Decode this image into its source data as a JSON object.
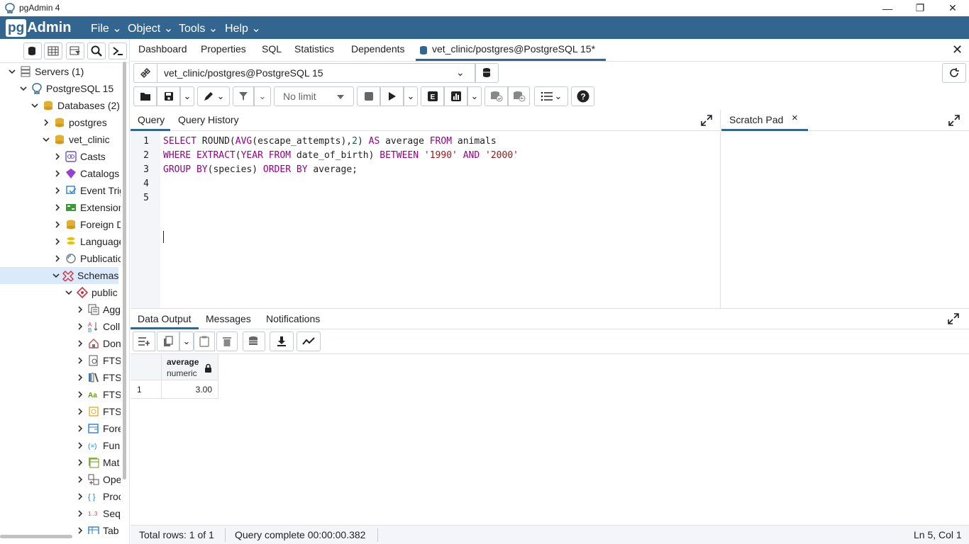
{
  "window": {
    "title": "pgAdmin 4"
  },
  "menubar": {
    "logo_pg": "pg",
    "logo_admin": "Admin",
    "items": [
      "File",
      "Object",
      "Tools",
      "Help"
    ]
  },
  "sidebar": {
    "tree": [
      {
        "label": "Servers (1)"
      },
      {
        "label": "PostgreSQL 15"
      },
      {
        "label": "Databases (2)"
      },
      {
        "label": "postgres"
      },
      {
        "label": "vet_clinic"
      },
      {
        "label": "Casts"
      },
      {
        "label": "Catalogs"
      },
      {
        "label": "Event Trig"
      },
      {
        "label": "Extension"
      },
      {
        "label": "Foreign D"
      },
      {
        "label": "Language"
      },
      {
        "label": "Publicatio"
      },
      {
        "label": "Schemas"
      },
      {
        "label": "public"
      },
      {
        "label": "Agg"
      },
      {
        "label": "Coll"
      },
      {
        "label": "Don"
      },
      {
        "label": "FTS"
      },
      {
        "label": "FTS"
      },
      {
        "label": "FTS"
      },
      {
        "label": "FTS"
      },
      {
        "label": "Fore"
      },
      {
        "label": "Fun"
      },
      {
        "label": "Mat"
      },
      {
        "label": "Ope"
      },
      {
        "label": "Proc"
      },
      {
        "label": "Seq"
      },
      {
        "label": "Tab"
      }
    ]
  },
  "tabs": [
    "Dashboard",
    "Properties",
    "SQL",
    "Statistics",
    "Dependents",
    "vet_clinic/postgres@PostgreSQL 15*"
  ],
  "connection": {
    "label": "vet_clinic/postgres@PostgreSQL 15"
  },
  "toolbar": {
    "limit": "No limit"
  },
  "query": {
    "tabs": [
      "Query",
      "Query History"
    ],
    "line_numbers": [
      "1",
      "2",
      "3",
      "4",
      "5"
    ],
    "lines": [
      [
        {
          "t": "SELECT",
          "c": "kw"
        },
        {
          "t": " ROUND(",
          "c": ""
        },
        {
          "t": "AVG",
          "c": "kw"
        },
        {
          "t": "(escape_attempts),",
          "c": ""
        },
        {
          "t": "2",
          "c": "num"
        },
        {
          "t": ") ",
          "c": ""
        },
        {
          "t": "AS",
          "c": "kw"
        },
        {
          "t": " average ",
          "c": ""
        },
        {
          "t": "FROM",
          "c": "kw"
        },
        {
          "t": " animals",
          "c": ""
        }
      ],
      [
        {
          "t": "WHERE",
          "c": "kw"
        },
        {
          "t": " ",
          "c": ""
        },
        {
          "t": "EXTRACT",
          "c": "kw"
        },
        {
          "t": "(",
          "c": ""
        },
        {
          "t": "YEAR",
          "c": "kw"
        },
        {
          "t": " ",
          "c": ""
        },
        {
          "t": "FROM",
          "c": "kw"
        },
        {
          "t": " date_of_birth) ",
          "c": ""
        },
        {
          "t": "BETWEEN",
          "c": "kw"
        },
        {
          "t": " ",
          "c": ""
        },
        {
          "t": "'1990'",
          "c": "str"
        },
        {
          "t": " ",
          "c": ""
        },
        {
          "t": "AND",
          "c": "kw"
        },
        {
          "t": " ",
          "c": ""
        },
        {
          "t": "'2000'",
          "c": "str"
        }
      ],
      [
        {
          "t": "GROUP BY",
          "c": "kw"
        },
        {
          "t": "(species) ",
          "c": ""
        },
        {
          "t": "ORDER BY",
          "c": "kw"
        },
        {
          "t": " average;",
          "c": ""
        }
      ],
      [],
      []
    ]
  },
  "scratch": {
    "title": "Scratch Pad",
    "close": "×"
  },
  "output": {
    "tabs": [
      "Data Output",
      "Messages",
      "Notifications"
    ],
    "column": {
      "name": "average",
      "type": "numeric"
    },
    "rows": [
      {
        "num": "1",
        "value": "3.00"
      }
    ]
  },
  "status": {
    "rows": "Total rows: 1 of 1",
    "query": "Query complete 00:00:00.382",
    "position": "Ln 5, Col 1"
  },
  "colors": {
    "brand": "#326690",
    "keyword": "#990088",
    "string": "#aa1111",
    "number": "#116644"
  }
}
